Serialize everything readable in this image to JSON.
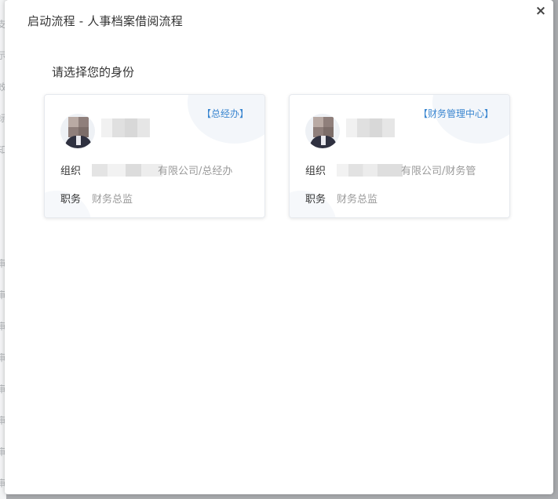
{
  "modal": {
    "title": "启动流程 - 人事档案借阅流程",
    "close_label": "×"
  },
  "prompt": "请选择您的身份",
  "background_edge_chars": [
    "支",
    "示",
    "效",
    "标",
    "知",
    "",
    ")",
    "审",
    "审",
    "审",
    "审",
    "审",
    "审",
    "审",
    "审"
  ],
  "cards": [
    {
      "dept_tag": "【总经办】",
      "org_label": "组织",
      "org_value": "有限公司/总经办",
      "position_label": "职务",
      "position_value": "财务总监"
    },
    {
      "dept_tag": "【财务管理中心】",
      "org_label": "组织",
      "org_value": "有限公司/财务管",
      "position_label": "职务",
      "position_value": "财务总监"
    }
  ],
  "colors": {
    "accent": "#3a86d0",
    "text": "#333333",
    "muted": "#9a9a9a"
  }
}
